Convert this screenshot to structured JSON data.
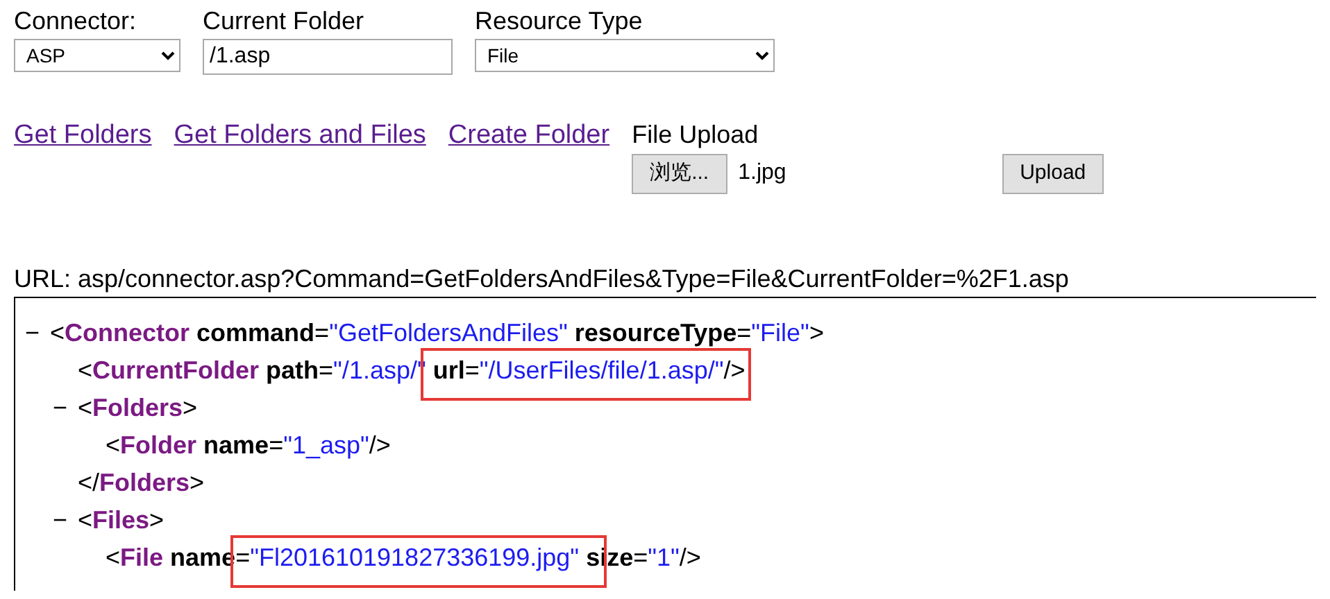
{
  "form": {
    "fields": [
      {
        "kind": "select",
        "label": "Connector:",
        "value": "ASP"
      },
      {
        "kind": "text",
        "label": "Current Folder",
        "value": "/1.asp"
      },
      {
        "kind": "select",
        "label": "Resource Type",
        "value": "File"
      }
    ]
  },
  "commands": [
    {
      "label": "Get Folders"
    },
    {
      "label": "Get Folders and Files"
    },
    {
      "label": "Create Folder"
    }
  ],
  "upload": {
    "label": "File Upload",
    "browse_button": "浏览...",
    "file_name": "1.jpg",
    "upload_button": "Upload"
  },
  "url": "URL: asp/connector.asp?Command=GetFoldersAndFiles&Type=File&CurrentFolder=%2F1.asp",
  "xml": [
    {
      "toggle": "−",
      "tokens": [
        {
          "kind": "punct",
          "text": "<"
        },
        {
          "kind": "tag",
          "text": "Connector"
        },
        {
          "kind": "attr",
          "text": " command"
        },
        {
          "kind": "punct",
          "text": "="
        },
        {
          "kind": "value",
          "text": "\"GetFoldersAndFiles\""
        },
        {
          "kind": "attr",
          "text": " resourceType"
        },
        {
          "kind": "punct",
          "text": "="
        },
        {
          "kind": "value",
          "text": "\"File\""
        },
        {
          "kind": "punct",
          "text": ">"
        }
      ],
      "children": [
        {
          "tokens": [
            {
              "kind": "punct",
              "text": "<"
            },
            {
              "kind": "tag",
              "text": "CurrentFolder"
            },
            {
              "kind": "attr",
              "text": " path"
            },
            {
              "kind": "punct",
              "text": "="
            },
            {
              "kind": "value",
              "text": "\"/1.asp/\""
            },
            {
              "kind": "attr",
              "text": " url",
              "highlight": true
            },
            {
              "kind": "punct",
              "text": "=",
              "highlight": true
            },
            {
              "kind": "value",
              "text": "\"/UserFiles/file/1.asp/\"",
              "highlight": true
            },
            {
              "kind": "punct",
              "text": "/>"
            }
          ]
        },
        {
          "toggle": "−",
          "tokens": [
            {
              "kind": "punct",
              "text": "<"
            },
            {
              "kind": "tag",
              "text": "Folders"
            },
            {
              "kind": "punct",
              "text": ">"
            }
          ],
          "children": [
            {
              "tokens": [
                {
                  "kind": "punct",
                  "text": "<"
                },
                {
                  "kind": "tag",
                  "text": "Folder"
                },
                {
                  "kind": "attr",
                  "text": " name"
                },
                {
                  "kind": "punct",
                  "text": "="
                },
                {
                  "kind": "value",
                  "text": "\"1_asp\""
                },
                {
                  "kind": "punct",
                  "text": "/>"
                }
              ]
            }
          ],
          "closing": [
            {
              "kind": "punct",
              "text": "</"
            },
            {
              "kind": "tag",
              "text": "Folders"
            },
            {
              "kind": "punct",
              "text": ">"
            }
          ]
        },
        {
          "toggle": "−",
          "tokens": [
            {
              "kind": "punct",
              "text": "<"
            },
            {
              "kind": "tag",
              "text": "Files"
            },
            {
              "kind": "punct",
              "text": ">"
            }
          ],
          "children": [
            {
              "tokens": [
                {
                  "kind": "punct",
                  "text": "<"
                },
                {
                  "kind": "tag",
                  "text": "File"
                },
                {
                  "kind": "attr",
                  "text": " name"
                },
                {
                  "kind": "punct",
                  "text": "=",
                  "highlight": true
                },
                {
                  "kind": "value",
                  "text": "\"Fl201610191827336199.jpg\"",
                  "highlight": true
                },
                {
                  "kind": "attr",
                  "text": " size"
                },
                {
                  "kind": "punct",
                  "text": "="
                },
                {
                  "kind": "value",
                  "text": "\"1\""
                },
                {
                  "kind": "punct",
                  "text": "/>"
                }
              ]
            }
          ]
        }
      ]
    }
  ]
}
